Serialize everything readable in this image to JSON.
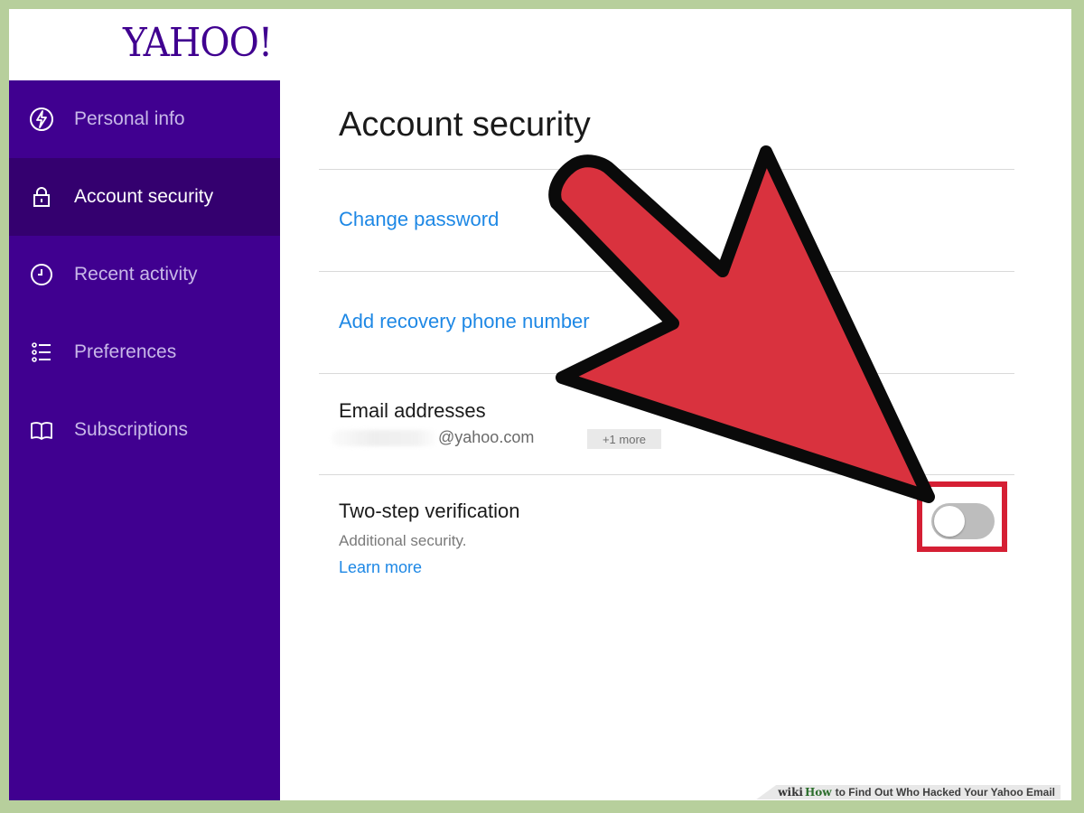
{
  "header": {
    "logo_text": "YAHOO!"
  },
  "sidebar": {
    "items": [
      {
        "label": "Personal info",
        "icon": "personal-info-icon",
        "active": false
      },
      {
        "label": "Account security",
        "icon": "lock-icon",
        "active": true
      },
      {
        "label": "Recent activity",
        "icon": "clock-icon",
        "active": false
      },
      {
        "label": "Preferences",
        "icon": "list-icon",
        "active": false
      },
      {
        "label": "Subscriptions",
        "icon": "book-icon",
        "active": false
      }
    ]
  },
  "main": {
    "title": "Account security",
    "change_password": "Change password",
    "add_recovery_phone": "Add recovery phone number",
    "email": {
      "title": "Email addresses",
      "domain": "@yahoo.com",
      "more": "+1 more"
    },
    "two_step": {
      "title": "Two-step verification",
      "subtitle": "Additional security.",
      "learn_more": "Learn more",
      "enabled": false
    }
  },
  "footer": {
    "brand_prefix": "wiki",
    "brand_how": "How",
    "text": "to Find Out Who Hacked Your Yahoo Email"
  },
  "colors": {
    "sidebar": "#400090",
    "sidebar_active": "#34006f",
    "link": "#1e88e5",
    "arrow": "#d9323e",
    "highlight_box": "#d51f34",
    "toggle_off": "#bdbdbd"
  }
}
